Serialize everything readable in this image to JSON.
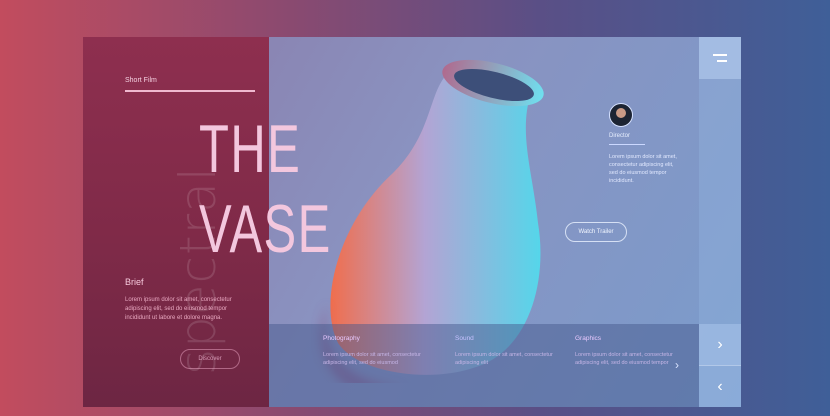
{
  "hero": {
    "vertical_word": "spectral",
    "short_film_label": "Short Film",
    "title_line1": "THE",
    "title_line2": "VASE"
  },
  "brief": {
    "heading": "Brief",
    "text": "Lorem ipsum dolor sit amet, consectetur adipiscing elit, sed do eiusmod tempor incididunt ut labore et dolore magna.",
    "button_label": "Discover"
  },
  "director": {
    "label": "Director",
    "text": "Lorem ipsum dolor sit amet, consectetur adipiscing elit, sed do eiusmod tempor incididunt."
  },
  "trailer": {
    "button_label": "Watch Trailer"
  },
  "bottom_info": [
    {
      "title": "Photography",
      "text": "Lorem ipsum dolor sit amet, consectetur adipiscing elit, sed do eiusmod"
    },
    {
      "title": "Sound",
      "text": "Lorem ipsum dolor sit amet, consectetur adipiscing elit"
    },
    {
      "title": "Graphics",
      "text": "Lorem ipsum dolor sit amet, consectetur adipiscing elit, sed do eiusmod tempor"
    }
  ],
  "icons": {
    "menu": "menu-icon",
    "next": "chevron-right-icon",
    "prev": "chevron-left-icon"
  },
  "colors": {
    "background_left": "#c24c5e",
    "background_right": "#3f5f98",
    "panel_left": "#8e2f4f",
    "title": "#f3c7de"
  }
}
